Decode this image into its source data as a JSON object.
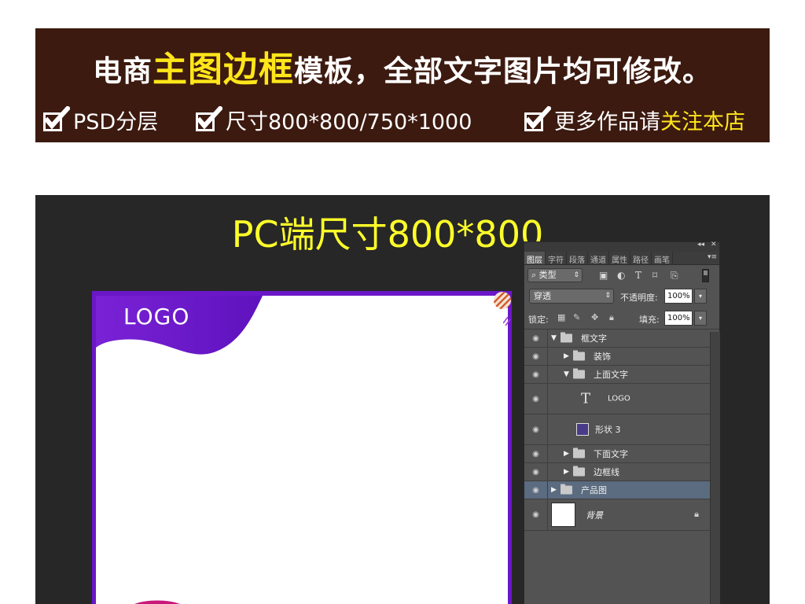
{
  "banner": {
    "title_part1": "电商",
    "title_highlight": "主图边框",
    "title_part2": "模板，全部文字图片均可修改。",
    "features": [
      {
        "text": "PSD分层",
        "highlight": ""
      },
      {
        "text": "尺寸800*800/750*1000",
        "highlight": ""
      },
      {
        "text": "更多作品请",
        "highlight": "关注本店"
      }
    ]
  },
  "screen": {
    "heading": "PC端尺寸800*800"
  },
  "template": {
    "logo": "LOGO"
  },
  "panel": {
    "tabs": [
      "图层",
      "字符",
      "段落",
      "通道",
      "属性",
      "路径",
      "画笔"
    ],
    "kind_select": "类型",
    "blend_mode": "穿透",
    "opacity_label": "不透明度:",
    "opacity_value": "100%",
    "lock_label": "锁定:",
    "fill_label": "填充:",
    "fill_value": "100%",
    "layers": [
      {
        "name": "框文字",
        "kind": "folder",
        "expanded": true
      },
      {
        "name": "装饰",
        "kind": "folder",
        "expanded": false
      },
      {
        "name": "上面文字",
        "kind": "folder",
        "expanded": true
      },
      {
        "name": "LOGO",
        "kind": "text"
      },
      {
        "name": "形状 3",
        "kind": "shape"
      },
      {
        "name": "下面文字",
        "kind": "folder",
        "expanded": false
      },
      {
        "name": "边框线",
        "kind": "folder",
        "expanded": false
      },
      {
        "name": "产品图",
        "kind": "folder",
        "expanded": false,
        "selected": true
      },
      {
        "name": "背景",
        "kind": "background",
        "locked": true
      }
    ]
  },
  "colors": {
    "banner_bg": "#3c1a10",
    "highlight_yellow": "#ffe61a",
    "screen_bg": "#272727",
    "frame_purple": "#6a17c8",
    "panel_bg": "#535353",
    "selected_layer": "#5b6b80"
  }
}
